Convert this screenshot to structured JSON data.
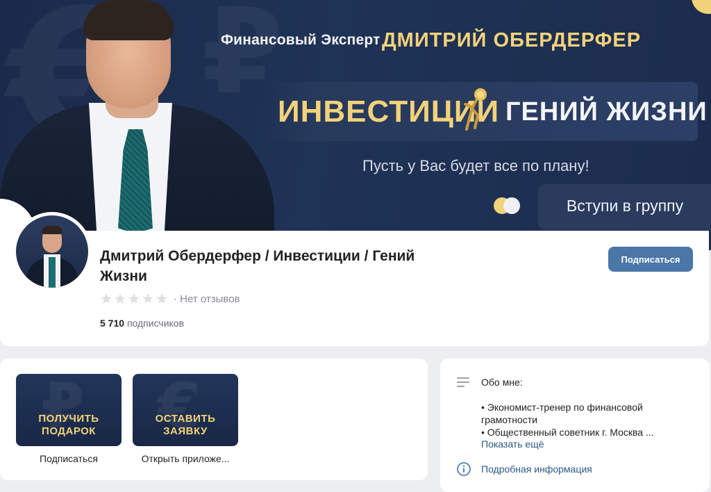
{
  "cover": {
    "subtitle": "Финансовый Эксперт",
    "name": "ДМИТРИЙ ОБЕРДЕРФЕР",
    "headline_left": "ИНВЕСТИЦИИ",
    "headline_right": "ГЕНИЙ ЖИЗНИ",
    "tagline": "Пусть у Вас будет все по плану!",
    "join_label": "Вступи в группу",
    "glyph_left": "€",
    "glyph_right": "₽",
    "colors": {
      "background": "#1f3357",
      "gold": "#f3d27a"
    }
  },
  "profile": {
    "title": "Дмитрий Обердерфер / Инвестиции / Гений Жизни",
    "rating_text": "· Нет отзывов",
    "subscribers_count": "5 710",
    "subscribers_label": "подписчиков",
    "subscribe_button": "Подписаться",
    "accent": "#4a76a8"
  },
  "apps": [
    {
      "line1": "ПОЛУЧИТЬ",
      "line2": "ПОДАРОК",
      "label": "Подписаться",
      "glyph": "₽"
    },
    {
      "line1": "ОСТАВИТЬ",
      "line2": "ЗАЯВКУ",
      "label": "Открыть приложе...",
      "glyph": "€"
    }
  ],
  "about": {
    "title": "Обо мне:",
    "line1": "• Экономист-тренер по финансовой грамотности",
    "line2": "• Общественный советник г. Москва ...",
    "show_more": "Показать ещё",
    "details": "Подробная информация",
    "icons": {
      "about": "text-lines-icon",
      "details": "info-circle-icon"
    }
  }
}
